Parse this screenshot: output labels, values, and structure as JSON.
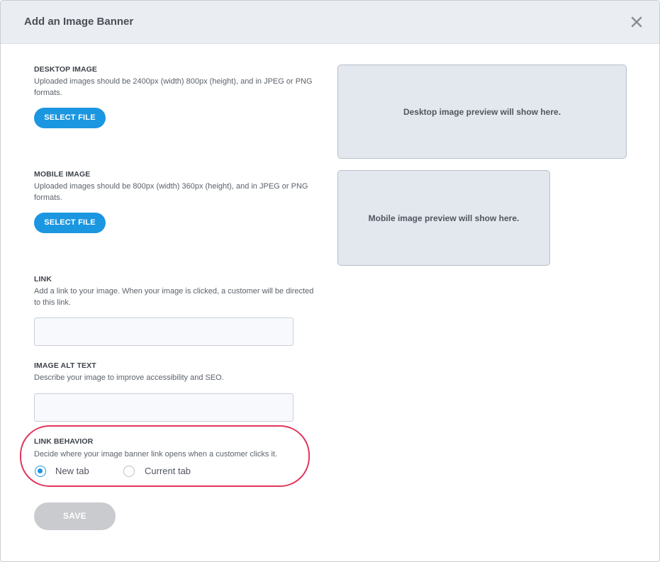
{
  "modal": {
    "title": "Add an Image Banner",
    "close_icon": "close-icon"
  },
  "desktop_image": {
    "label": "DESKTOP IMAGE",
    "description": "Uploaded images should be 2400px (width) 800px (height), and in JPEG or PNG formats.",
    "button_label": "SELECT FILE",
    "preview_text": "Desktop image preview will show here."
  },
  "mobile_image": {
    "label": "MOBILE IMAGE",
    "description": "Uploaded images should be 800px (width) 360px (height), and in JPEG or PNG formats.",
    "button_label": "SELECT FILE",
    "preview_text": "Mobile image preview will show here."
  },
  "link": {
    "label": "LINK",
    "description": "Add a link to your image. When your image is clicked, a customer will be directed to this link.",
    "value": "",
    "placeholder": ""
  },
  "alt_text": {
    "label": "IMAGE ALT TEXT",
    "description": "Describe your image to improve accessibility and SEO.",
    "value": "",
    "placeholder": ""
  },
  "link_behavior": {
    "label": "LINK BEHAVIOR",
    "description": "Decide where your image banner link opens when a customer clicks it.",
    "options": [
      {
        "label": "New tab",
        "selected": true
      },
      {
        "label": "Current tab",
        "selected": false
      }
    ]
  },
  "save_button": {
    "label": "SAVE",
    "disabled": true
  },
  "colors": {
    "primary": "#1b96e0",
    "highlight": "#e0365c",
    "header_bg": "#eaedf1",
    "preview_bg": "#e3e7ee",
    "disabled": "#c9cbcf"
  }
}
